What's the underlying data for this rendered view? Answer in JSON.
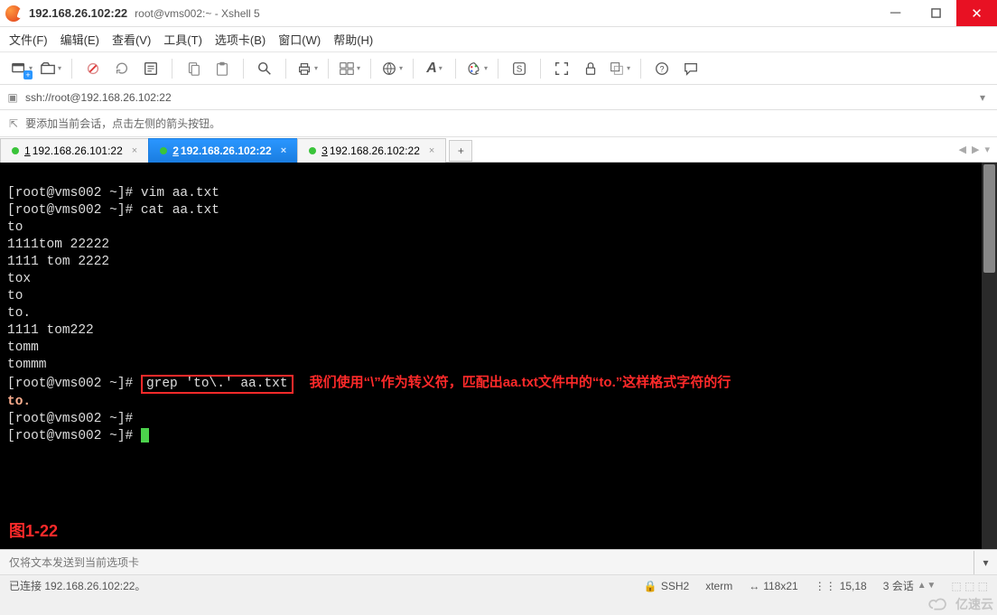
{
  "title": {
    "ip": "192.168.26.102:22",
    "sub": "root@vms002:~ - Xshell 5"
  },
  "menu": {
    "items": [
      "文件(F)",
      "编辑(E)",
      "查看(V)",
      "工具(T)",
      "选项卡(B)",
      "窗口(W)",
      "帮助(H)"
    ]
  },
  "address": {
    "value": "ssh://root@192.168.26.102:22"
  },
  "hint": {
    "text": "要添加当前会话，点击左侧的箭头按钮。"
  },
  "tabs": {
    "items": [
      {
        "num": "1",
        "label": "192.168.26.101:22",
        "active": false
      },
      {
        "num": "2",
        "label": "192.168.26.102:22",
        "active": true
      },
      {
        "num": "3",
        "label": "192.168.26.102:22",
        "active": false
      }
    ]
  },
  "term": {
    "l1": "[root@vms002 ~]# vim aa.txt",
    "l2": "[root@vms002 ~]# cat aa.txt",
    "l3": "to",
    "l4": "1111tom 22222",
    "l5": "1111 tom 2222",
    "l6": "tox",
    "l7": "to",
    "l8": "to.",
    "l9": "1111 tom222",
    "l10": "tomm",
    "l11": "tommm",
    "l12_prompt": "[root@vms002 ~]# ",
    "l12_cmd": "grep 'to\\.' aa.txt",
    "l12_anno": "我们使用“\\”作为转义符，匹配出aa.txt文件中的“to.”这样格式字符的行",
    "l13": "to.",
    "l14": "[root@vms002 ~]#",
    "l15": "[root@vms002 ~]# ",
    "figlabel": "图1-22"
  },
  "sendbar": {
    "placeholder": "仅将文本发送到当前选项卡"
  },
  "status": {
    "conn": "已连接 192.168.26.102:22。",
    "ssh": "SSH2",
    "term": "xterm",
    "size": "118x21",
    "pos": "15,18",
    "sess": "3 会话"
  },
  "watermark": "亿速云"
}
